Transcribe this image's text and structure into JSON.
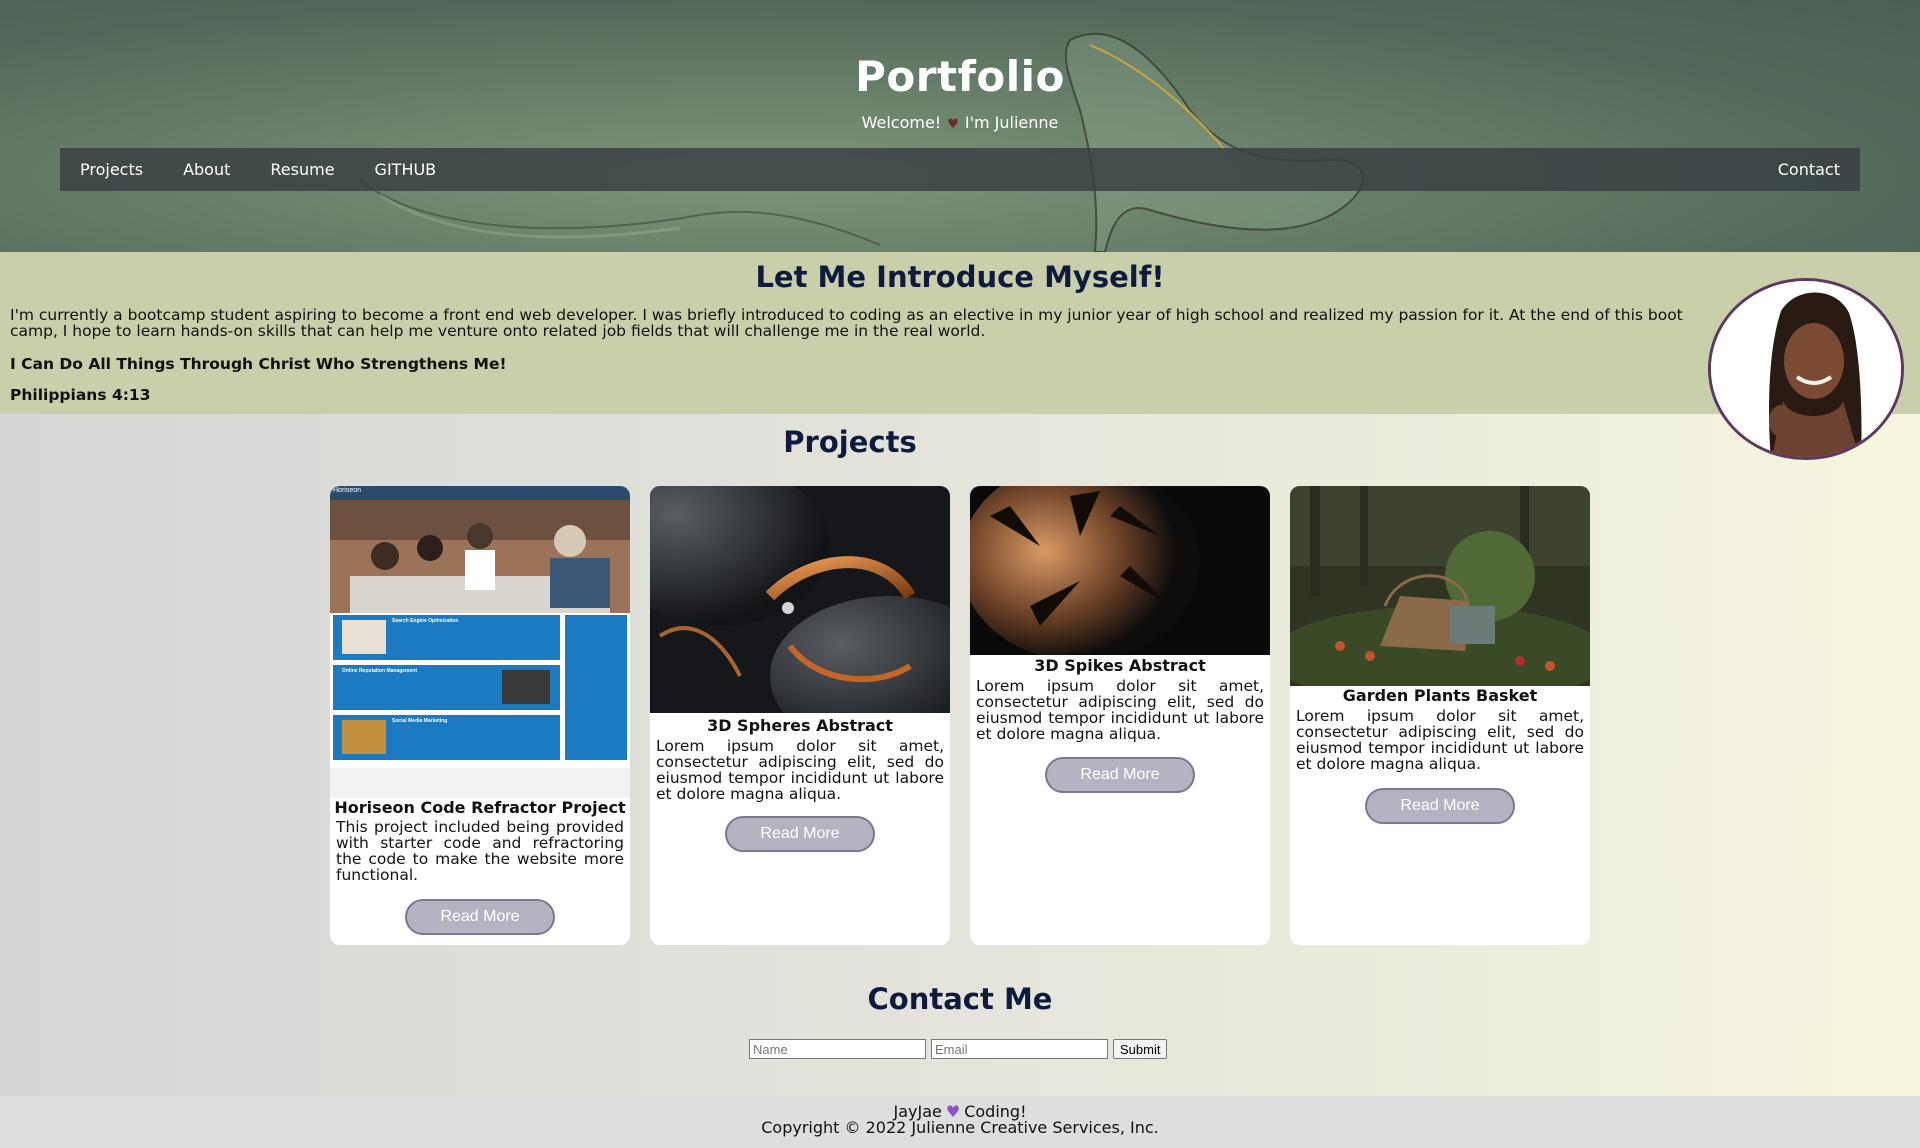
{
  "header": {
    "title": "Portfolio",
    "welcome": "Welcome!",
    "heart_glyph": "♥",
    "name_line": "I'm Julienne"
  },
  "nav": {
    "items": [
      "Projects",
      "About",
      "Resume",
      "GITHUB"
    ],
    "contact": "Contact"
  },
  "intro": {
    "heading": "Let Me Introduce Myself!",
    "bio": "I'm currently a bootcamp student aspiring to become a front end web developer. I was briefly introduced to coding as an elective in my junior year of high school and realized my passion for it. At the end of this boot camp, I hope to learn hands-on skills that can help me venture onto related job fields that will challenge me in the real world.",
    "verse": "I Can Do All Things Through Christ Who Strengthens Me!",
    "reference": "Philippians 4:13"
  },
  "projects": {
    "heading": "Projects",
    "cards": [
      {
        "title": "Horiseon Code Refractor Project",
        "text": "This project included being provided with starter code and refractoring the code to make the website more functional.",
        "button": "Read More",
        "mock_brand": "Horiseon",
        "mock_sections": [
          "Search Engine Optimization",
          "Online Reputation Management",
          "Social Media Marketing"
        ]
      },
      {
        "title": "3D Spheres Abstract",
        "text": "Lorem ipsum dolor sit amet, consectetur adipiscing elit, sed do eiusmod tempor incididunt ut labore et dolore magna aliqua.",
        "button": "Read More"
      },
      {
        "title": "3D Spikes Abstract",
        "text": "Lorem ipsum dolor sit amet, consectetur adipiscing elit, sed do eiusmod tempor incididunt ut labore et dolore magna aliqua.",
        "button": "Read More"
      },
      {
        "title": "Garden Plants Basket",
        "text": "Lorem ipsum dolor sit amet, consectetur adipiscing elit, sed do eiusmod tempor incididunt ut labore et dolore magna aliqua.",
        "button": "Read More"
      }
    ]
  },
  "contact": {
    "heading": "Contact Me",
    "name_placeholder": "Name",
    "email_placeholder": "Email",
    "submit": "Submit"
  },
  "footer": {
    "brand_left": "JayJae",
    "heart_glyph": "♥",
    "brand_right": "Coding!",
    "copyright": "Copyright © 2022 Julienne Creative Services, Inc."
  },
  "colors": {
    "hero_green": "#5f7763",
    "intro_bg": "#c9cfab",
    "heading_navy": "#0f1b3d",
    "button_lavender": "#b7b2c2"
  }
}
